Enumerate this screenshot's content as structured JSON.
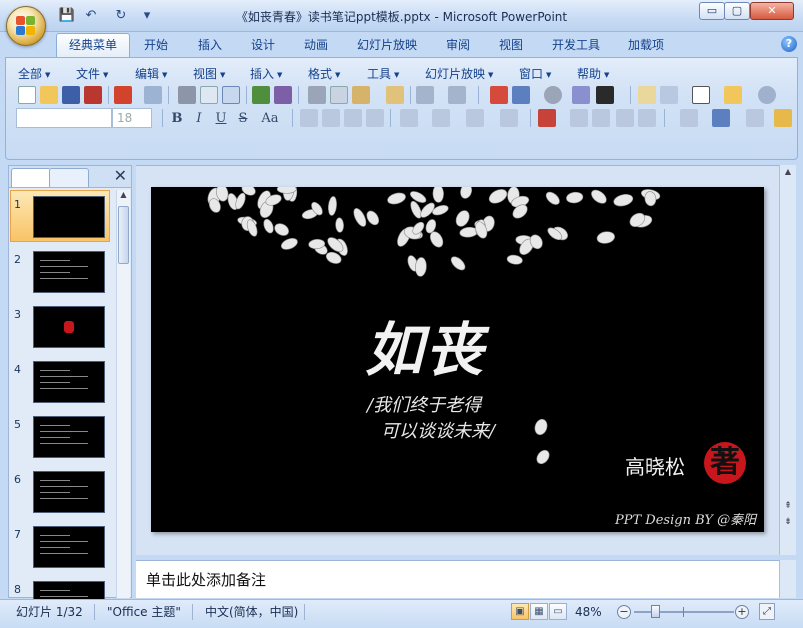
{
  "window": {
    "title": "《如丧青春》读书笔记ppt模板.pptx - Microsoft PowerPoint",
    "minimize": "▭",
    "maximize": "▢",
    "close": "✕"
  },
  "qat": {
    "save": "💾",
    "undo": "↶",
    "redo": "↻",
    "customize": "▾"
  },
  "tabs": [
    "经典菜单",
    "开始",
    "插入",
    "设计",
    "动画",
    "幻灯片放映",
    "审阅",
    "视图",
    "开发工具",
    "加载项"
  ],
  "help": "?",
  "menubar": [
    "全部",
    "文件",
    "编辑",
    "视图",
    "插入",
    "格式",
    "工具",
    "幻灯片放映",
    "窗口",
    "帮助"
  ],
  "toolbar": {
    "font_name": "",
    "font_size": "18",
    "bold": "B",
    "italic": "I",
    "underline": "U",
    "strike": "S",
    "aa": "Aa"
  },
  "panel": {
    "close": "✕",
    "slides": [
      {
        "num": "1"
      },
      {
        "num": "2"
      },
      {
        "num": "3"
      },
      {
        "num": "4"
      },
      {
        "num": "5"
      },
      {
        "num": "6"
      },
      {
        "num": "7"
      },
      {
        "num": "8"
      }
    ]
  },
  "slide": {
    "title": "如丧",
    "line1": "/我们终于老得",
    "line2": "可以谈谈未来/",
    "author": "高晓松",
    "seal": "著",
    "credit": "PPT Design BY @秦阳"
  },
  "notes_placeholder": "单击此处添加备注",
  "status": {
    "slide": "幻灯片 1/32",
    "theme": "\"Office 主题\"",
    "lang": "中文(简体，中国)",
    "zoom": "48%"
  },
  "colors": {
    "accent": "#15428b",
    "seal": "#c8161d",
    "selection": "#f9c366"
  }
}
